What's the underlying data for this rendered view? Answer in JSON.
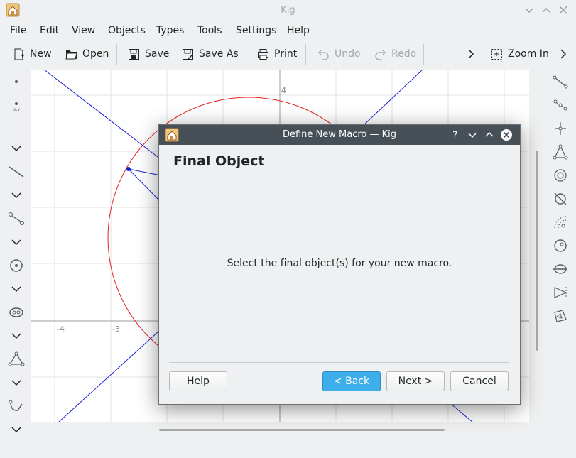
{
  "window": {
    "title": "Kig"
  },
  "menubar": {
    "items": [
      "File",
      "Edit",
      "View",
      "Objects",
      "Types",
      "Tools",
      "Settings",
      "Help"
    ]
  },
  "toolbar": {
    "new_label": "New",
    "open_label": "Open",
    "save_label": "Save",
    "save_as_label": "Save As",
    "print_label": "Print",
    "undo_label": "Undo",
    "redo_label": "Redo",
    "zoom_in_label": "Zoom In"
  },
  "canvas": {
    "tick_x_neg4": "-4",
    "tick_x_neg3": "-3",
    "tick_y_4": "4",
    "colors": {
      "circle": "#e32020",
      "lines": "#1a22d8",
      "grid": "#e3e3e3",
      "axis": "#9b9b9b"
    }
  },
  "dialog": {
    "title": "Define New Macro — Kig",
    "heading": "Final Object",
    "message": "Select the final object(s) for your new macro.",
    "help_label": "Help",
    "back_label": "< Back",
    "next_label": "Next >",
    "cancel_label": "Cancel",
    "accent_color": "#3daee9",
    "titlebar_color": "#475057"
  }
}
